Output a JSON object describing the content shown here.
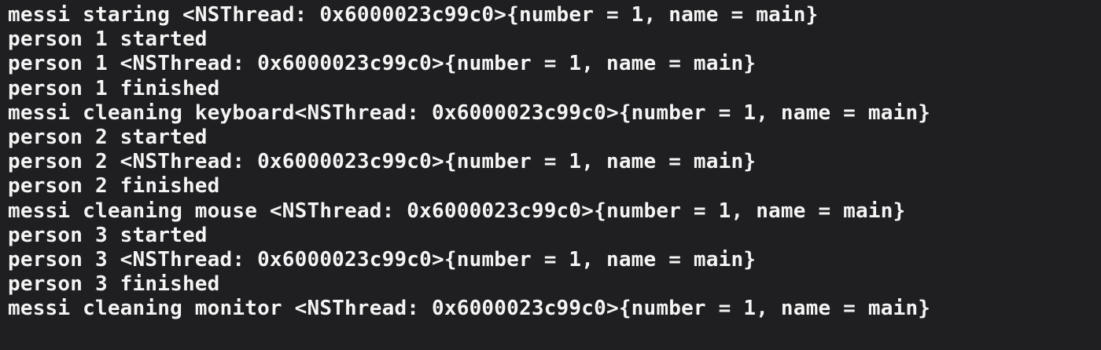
{
  "console": {
    "lines": [
      "messi staring <NSThread: 0x6000023c99c0>{number = 1, name = main}",
      "person 1 started",
      "person 1 <NSThread: 0x6000023c99c0>{number = 1, name = main}",
      "person 1 finished",
      "messi cleaning keyboard<NSThread: 0x6000023c99c0>{number = 1, name = main}",
      "person 2 started",
      "person 2 <NSThread: 0x6000023c99c0>{number = 1, name = main}",
      "person 2 finished",
      "messi cleaning mouse <NSThread: 0x6000023c99c0>{number = 1, name = main}",
      "person 3 started",
      "person 3 <NSThread: 0x6000023c99c0>{number = 1, name = main}",
      "person 3 finished",
      "messi cleaning monitor <NSThread: 0x6000023c99c0>{number = 1, name = main}"
    ]
  }
}
